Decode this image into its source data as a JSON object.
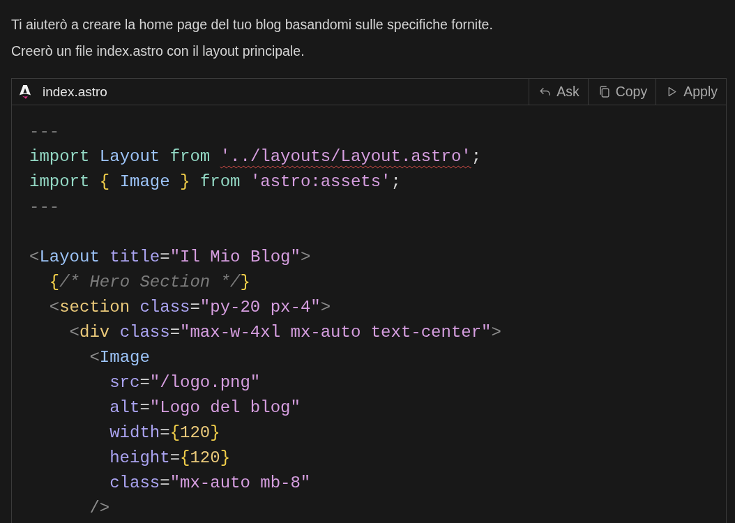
{
  "message": {
    "lines": [
      "Ti aiuterò a creare la home page del tuo blog basandomi sulle specifiche fornite.",
      "Creerò un file index.astro con il layout principale."
    ]
  },
  "code_block": {
    "filename": "index.astro",
    "actions": [
      {
        "kind": "ask",
        "label": "Ask"
      },
      {
        "kind": "copy",
        "label": "Copy"
      },
      {
        "kind": "apply",
        "label": "Apply"
      }
    ],
    "lines": [
      [
        {
          "kind": "comment",
          "text": "---"
        }
      ],
      [
        {
          "kind": "keyword",
          "text": "import "
        },
        {
          "kind": "ident",
          "text": "Layout "
        },
        {
          "kind": "keyword",
          "text": "from "
        },
        {
          "kind": "error_string",
          "text": "'../layouts/Layout.astro'"
        },
        {
          "kind": "plain",
          "text": ";"
        }
      ],
      [
        {
          "kind": "keyword",
          "text": "import "
        },
        {
          "kind": "brace",
          "text": "{ "
        },
        {
          "kind": "ident",
          "text": "Image "
        },
        {
          "kind": "brace",
          "text": "} "
        },
        {
          "kind": "keyword",
          "text": "from "
        },
        {
          "kind": "string",
          "text": "'astro:assets'"
        },
        {
          "kind": "plain",
          "text": ";"
        }
      ],
      [
        {
          "kind": "comment",
          "text": "---"
        }
      ],
      {
        "kind": "blank"
      },
      [
        {
          "kind": "punct",
          "text": "<"
        },
        {
          "kind": "ident",
          "text": "Layout "
        },
        {
          "kind": "attr",
          "text": "title"
        },
        {
          "kind": "plain",
          "text": "="
        },
        {
          "kind": "string",
          "text": "\"Il Mio Blog\""
        },
        {
          "kind": "punct",
          "text": ">"
        }
      ],
      [
        {
          "kind": "brace",
          "text": "  {"
        },
        {
          "kind": "comment_italic",
          "text": "/* Hero Section */"
        },
        {
          "kind": "brace",
          "text": "}"
        }
      ],
      [
        {
          "kind": "punct",
          "text": "  <"
        },
        {
          "kind": "tag",
          "text": "section "
        },
        {
          "kind": "attr",
          "text": "class"
        },
        {
          "kind": "plain",
          "text": "="
        },
        {
          "kind": "string",
          "text": "\"py-20 px-4\""
        },
        {
          "kind": "punct",
          "text": ">"
        }
      ],
      [
        {
          "kind": "punct",
          "text": "    <"
        },
        {
          "kind": "tag",
          "text": "div "
        },
        {
          "kind": "attr",
          "text": "class"
        },
        {
          "kind": "plain",
          "text": "="
        },
        {
          "kind": "string",
          "text": "\"max-w-4xl mx-auto text-center\""
        },
        {
          "kind": "punct",
          "text": ">"
        }
      ],
      [
        {
          "kind": "punct",
          "text": "      <"
        },
        {
          "kind": "ident",
          "text": "Image"
        }
      ],
      [
        {
          "kind": "attr",
          "text": "        src"
        },
        {
          "kind": "plain",
          "text": "="
        },
        {
          "kind": "string",
          "text": "\"/logo.png\""
        }
      ],
      [
        {
          "kind": "attr",
          "text": "        alt"
        },
        {
          "kind": "plain",
          "text": "="
        },
        {
          "kind": "string",
          "text": "\"Logo del blog\""
        }
      ],
      [
        {
          "kind": "attr",
          "text": "        width"
        },
        {
          "kind": "plain",
          "text": "="
        },
        {
          "kind": "brace",
          "text": "{"
        },
        {
          "kind": "number",
          "text": "120"
        },
        {
          "kind": "brace",
          "text": "}"
        }
      ],
      [
        {
          "kind": "attr",
          "text": "        height"
        },
        {
          "kind": "plain",
          "text": "="
        },
        {
          "kind": "brace",
          "text": "{"
        },
        {
          "kind": "number",
          "text": "120"
        },
        {
          "kind": "brace",
          "text": "}"
        }
      ],
      [
        {
          "kind": "attr",
          "text": "        class"
        },
        {
          "kind": "plain",
          "text": "="
        },
        {
          "kind": "string",
          "text": "\"mx-auto mb-8\""
        }
      ],
      [
        {
          "kind": "punct",
          "text": "      />"
        }
      ]
    ]
  }
}
